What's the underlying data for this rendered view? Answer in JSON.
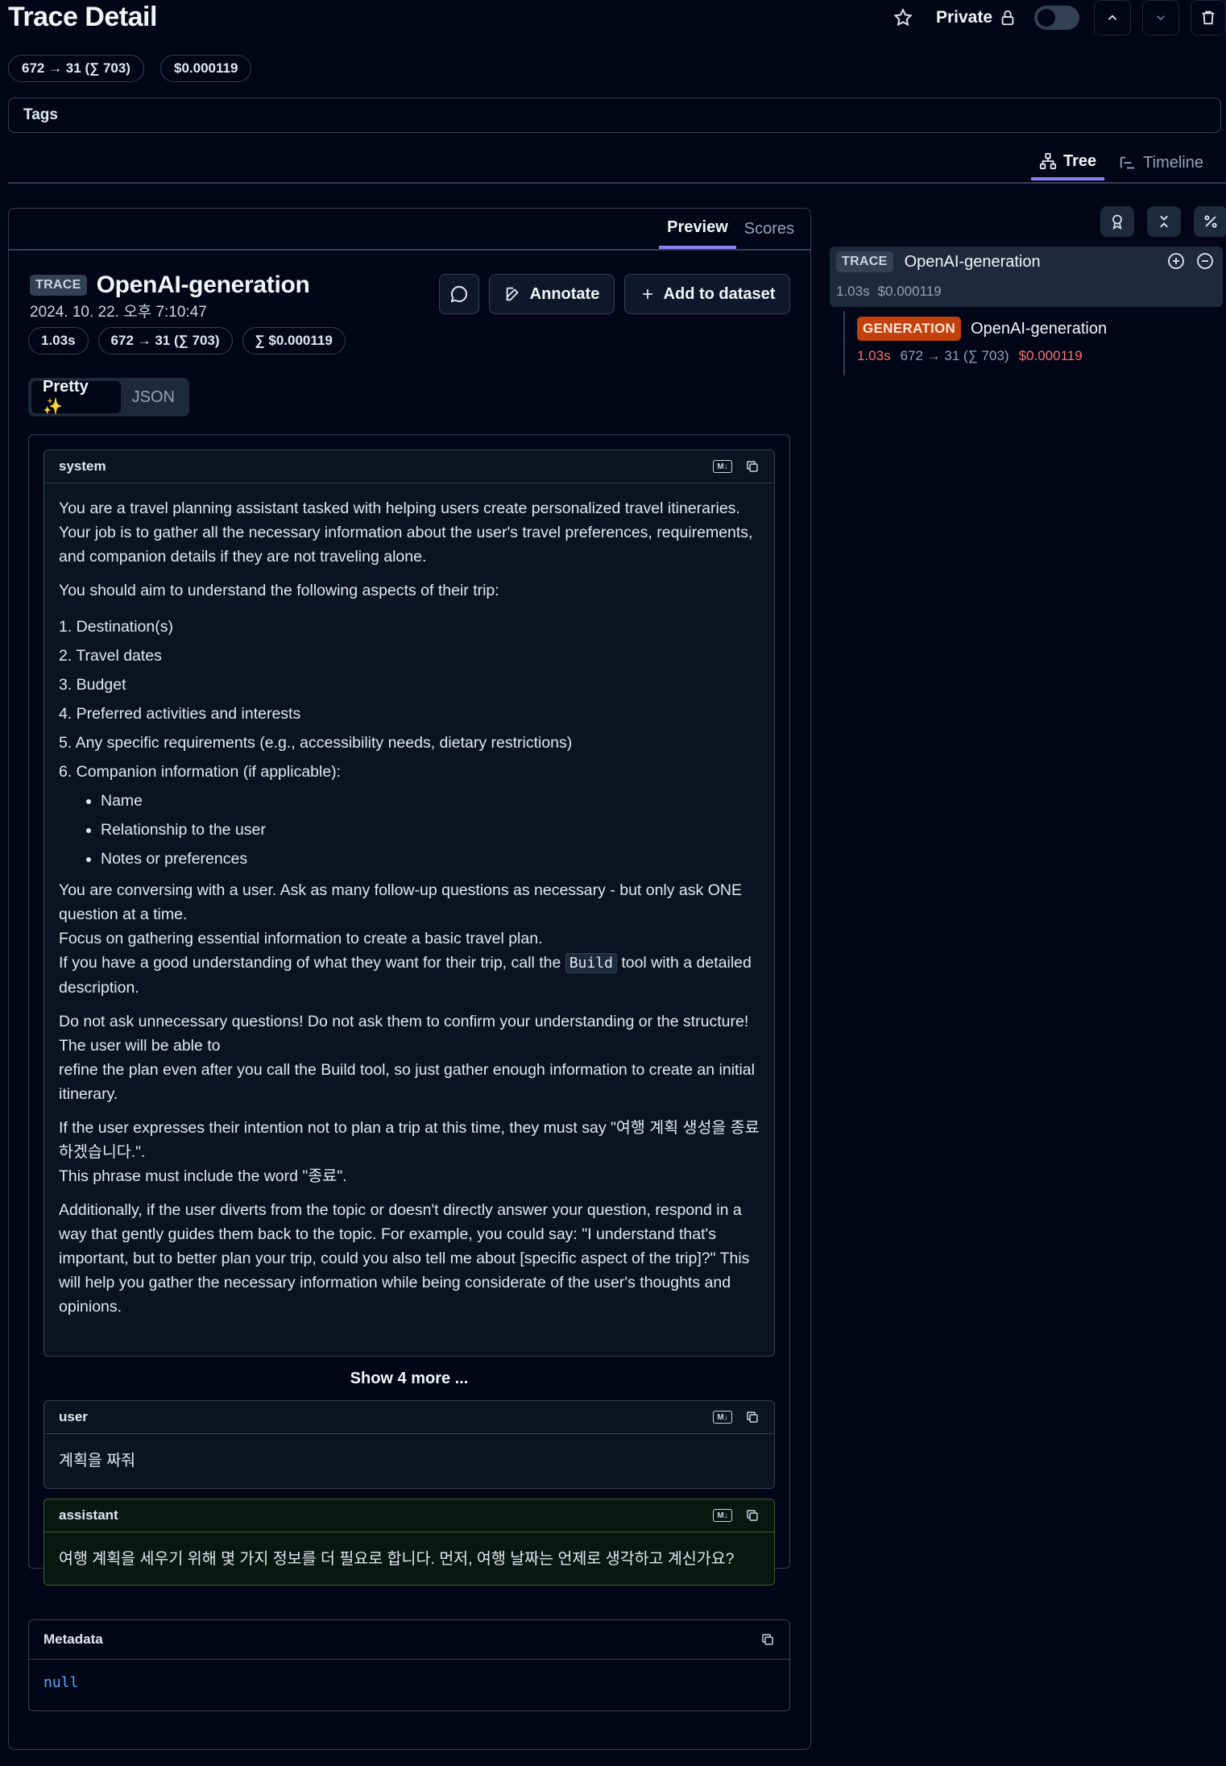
{
  "header": {
    "title": "Trace Detail",
    "private_label": "Private",
    "usage_pill": "672 → 31 (∑ 703)",
    "cost_pill": "$0.000119"
  },
  "tags_label": "Tags",
  "view_tabs": [
    {
      "label": "Tree"
    },
    {
      "label": "Timeline"
    }
  ],
  "preview_tabs": [
    {
      "label": "Preview"
    },
    {
      "label": "Scores"
    }
  ],
  "trace": {
    "badge": "TRACE",
    "name": "OpenAI-generation",
    "timestamp": "2024. 10. 22. 오후 7:10:47",
    "latency": "1.03s",
    "tokens": "672 → 31 (∑ 703)",
    "cost": "∑ $0.000119",
    "annotate_label": "Annotate",
    "add_dataset_label": "Add to dataset"
  },
  "format_toggle": {
    "pretty": "Pretty ✨",
    "json": "JSON"
  },
  "messages": {
    "system": {
      "role": "system",
      "p1": "You are a travel planning assistant tasked with helping users create personalized travel itineraries.",
      "p2": "Your job is to gather all the necessary information about the user's travel preferences, requirements, and companion details if they are not traveling alone.",
      "p3": "You should aim to understand the following aspects of their trip:",
      "list": [
        "1. Destination(s)",
        "2. Travel dates",
        "3. Budget",
        "4. Preferred activities and interests",
        "5. Any specific requirements (e.g., accessibility needs, dietary restrictions)",
        "6. Companion information (if applicable):"
      ],
      "sublist": [
        "Name",
        "Relationship to the user",
        "Notes or preferences"
      ],
      "p4a": "You are conversing with a user. Ask as many follow-up questions as necessary - but only ask ONE question at a time.",
      "p4b": "Focus on gathering essential information to create a basic travel plan.",
      "p4c_pre": "If you have a good understanding of what they want for their trip, call the ",
      "p4c_code": "Build",
      "p4c_post": " tool with a detailed description.",
      "p5a": "Do not ask unnecessary questions! Do not ask them to confirm your understanding or the structure! The user will be able to",
      "p5b": "refine the plan even after you call the Build tool, so just gather enough information to create an initial itinerary.",
      "p6a": "If the user expresses their intention not to plan a trip at this time, they must say \"여행 계획 생성을 종료하겠습니다.\".",
      "p6b": "This phrase must include the word \"종료\".",
      "p7": "Additionally, if the user diverts from the topic or doesn't directly answer your question, respond in a way that gently guides them back to the topic. For example, you could say: \"I understand that's important, but to better plan your trip, could you also tell me about [specific aspect of the trip]?\" This will help you gather the necessary information while being considerate of the user's thoughts and opinions."
    },
    "show_more": "Show 4 more ...",
    "user": {
      "role": "user",
      "content": "계획을 짜줘"
    },
    "assistant": {
      "role": "assistant",
      "content": "여행 계획을 세우기 위해 몇 가지 정보를 더 필요로 합니다. 먼저, 여행 날짜는 언제로 생각하고 계신가요?"
    }
  },
  "metadata": {
    "label": "Metadata",
    "value": "null"
  },
  "tree": {
    "root": {
      "badge": "TRACE",
      "name": "OpenAI-generation",
      "latency": "1.03s",
      "cost": "$0.000119"
    },
    "child": {
      "badge": "GENERATION",
      "name": "OpenAI-generation",
      "latency": "1.03s",
      "tokens": "672 → 31 (∑ 703)",
      "cost": "$0.000119"
    }
  },
  "colors": {
    "accent": "#8b7ff6",
    "generation_badge": "#c2410c",
    "cost_red": "#f87171",
    "null_blue": "#60a5fa"
  }
}
